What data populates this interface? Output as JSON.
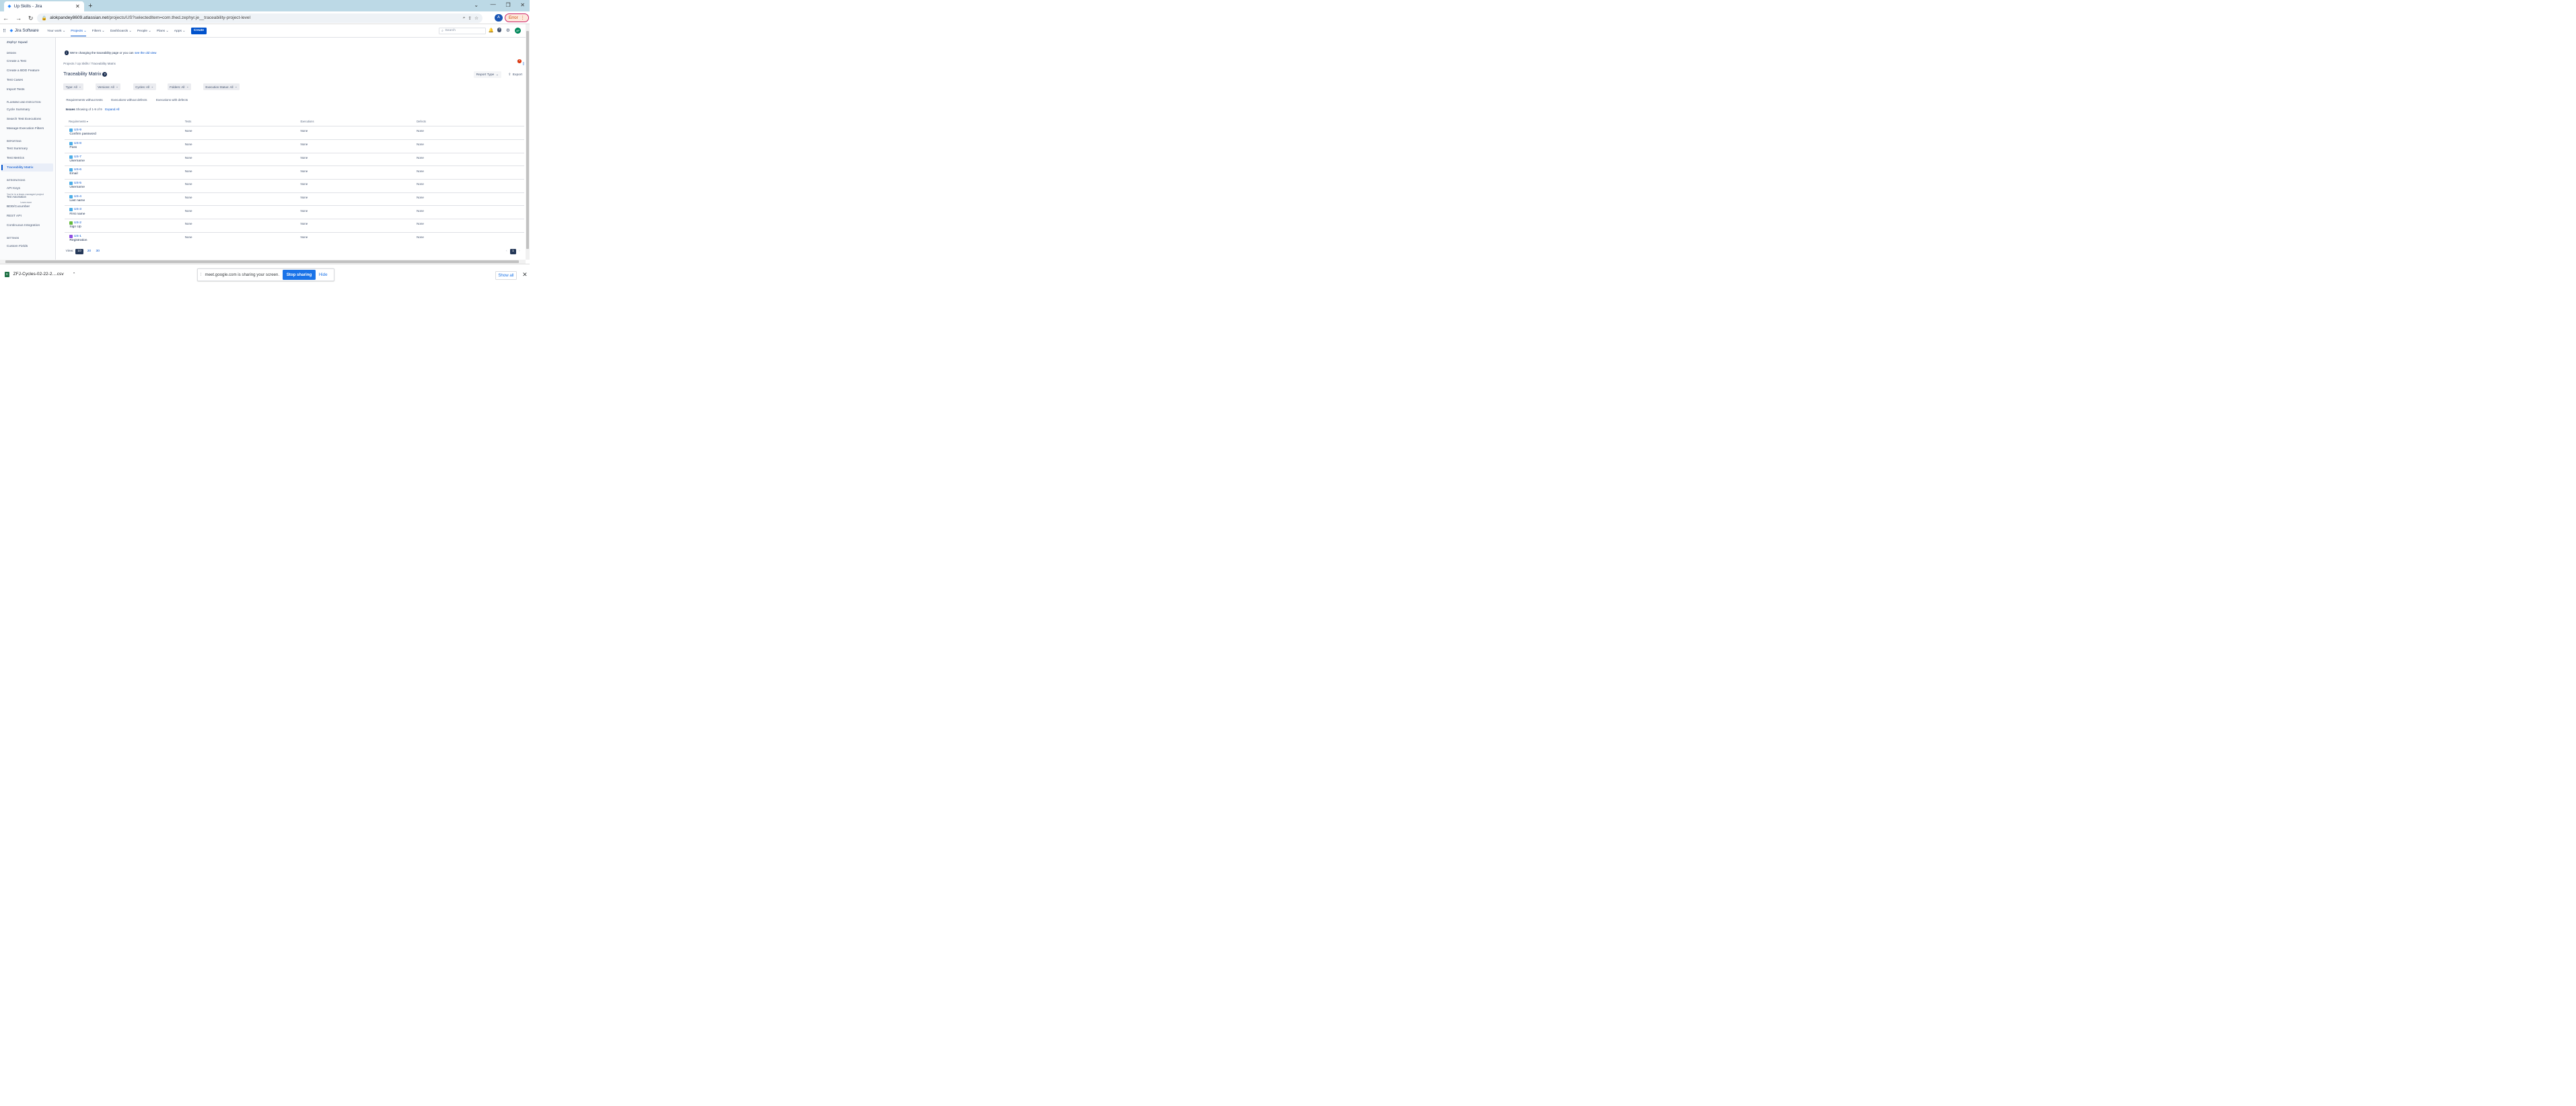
{
  "browser": {
    "tab_title": "Up Skills - Jira",
    "url_host": "alokpandey8609.atlassian.net",
    "url_path": "/projects/US?selectedItem=com.thed.zephyr.je__traceability-project-level",
    "error_label": "Error",
    "avatar_letter": "A"
  },
  "topnav": {
    "brand": "Jira Software",
    "items": [
      "Your work",
      "Projects",
      "Filters",
      "Dashboards",
      "People",
      "Plans",
      "Apps"
    ],
    "create": "Create",
    "search_placeholder": "Search",
    "avatar_initials": "AP"
  },
  "sidebar": {
    "project": "Zephyr Squad",
    "sections": [
      {
        "title": "DESIGN",
        "items": [
          "Create a Test",
          "Create a BDD Feature",
          "Test Cases",
          "Import Tests"
        ]
      },
      {
        "title": "PLANNING AND EXECUTION",
        "items": [
          "Cycle Summary",
          "Search Test Executions",
          "Manage Execution Filters"
        ]
      },
      {
        "title": "REPORTING",
        "items": [
          "Test Summary",
          "Test Metrics",
          "Traceability Matrix"
        ]
      },
      {
        "title": "INTEGRATIONS",
        "items": [
          "API Keys",
          "Test Automation",
          "BDD/Cucumber",
          "REST API",
          "Continuous Integration"
        ]
      },
      {
        "title": "SETTINGS",
        "items": [
          "Custom Fields"
        ]
      }
    ],
    "overlay_text": "You're in a team-managed project",
    "learn_more": "Learn more"
  },
  "notice": {
    "text": "We're changing the traceability page or you can",
    "link": "see the old view"
  },
  "breadcrumb": "Projects  /  Up Skills  /  Traceability Matrix",
  "page_title": "Traceability Matrix",
  "report_type": "Report Type",
  "export": "Export",
  "notification_count": "4",
  "filters": [
    "Type: All",
    "Versions: All",
    "Cycles: All",
    "Folders: All",
    "Execution Status: All"
  ],
  "subtabs": [
    "Requirements without tests",
    "Executions without defects",
    "Executions with defects"
  ],
  "issues": {
    "label": "Issues",
    "showing": "Showing of 1-9 of 9",
    "expand": "Expand All"
  },
  "table": {
    "headers": [
      "Requirements",
      "Tests",
      "Executions",
      "Defects"
    ],
    "rows": [
      {
        "key": "US-9",
        "summary": "Confirm password",
        "tests": "None",
        "executions": "None",
        "defects": "None",
        "type_color": "#4bade8"
      },
      {
        "key": "US-8",
        "summary": "Pass",
        "tests": "None",
        "executions": "None",
        "defects": "None",
        "type_color": "#4bade8"
      },
      {
        "key": "US-7",
        "summary": "Username",
        "tests": "None",
        "executions": "None",
        "defects": "None",
        "type_color": "#4bade8"
      },
      {
        "key": "US-6",
        "summary": "Email",
        "tests": "None",
        "executions": "None",
        "defects": "None",
        "type_color": "#4bade8"
      },
      {
        "key": "US-5",
        "summary": "Username",
        "tests": "None",
        "executions": "None",
        "defects": "None",
        "type_color": "#4bade8"
      },
      {
        "key": "US-4",
        "summary": "Last name",
        "tests": "None",
        "executions": "None",
        "defects": "None",
        "type_color": "#4bade8"
      },
      {
        "key": "US-3",
        "summary": "First name",
        "tests": "None",
        "executions": "None",
        "defects": "None",
        "type_color": "#4bade8"
      },
      {
        "key": "US-2",
        "summary": "Sign Up",
        "tests": "None",
        "executions": "None",
        "defects": "None",
        "type_color": "#63ba3c"
      },
      {
        "key": "US-1",
        "summary": "Registration",
        "tests": "None",
        "executions": "None",
        "defects": "None",
        "type_color": "#904ee2"
      }
    ]
  },
  "pagination": {
    "view_label": "View:",
    "sizes": [
      "10",
      "20",
      "30"
    ],
    "page": "1"
  },
  "download": {
    "file": "ZFJ-Cycles-02-22-2....csv"
  },
  "sharebar": {
    "text": "meet.google.com is sharing your screen.",
    "stop": "Stop sharing",
    "hide": "Hide"
  },
  "showall": "Show all"
}
